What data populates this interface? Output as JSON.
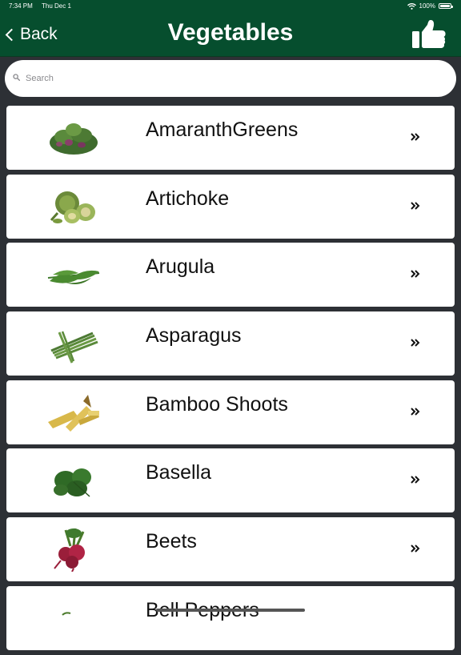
{
  "status_bar": {
    "time": "7:34 PM",
    "date": "Thu Dec 1",
    "battery": "100%"
  },
  "nav": {
    "back_label": "Back",
    "title": "Vegetables",
    "like_icon": "thumbs-up-icon"
  },
  "search": {
    "placeholder": "Search",
    "value": ""
  },
  "vegetables": [
    {
      "name": "AmaranthGreens",
      "image": "amaranth-greens-image"
    },
    {
      "name": "Artichoke",
      "image": "artichoke-image"
    },
    {
      "name": "Arugula",
      "image": "arugula-image"
    },
    {
      "name": "Asparagus",
      "image": "asparagus-image"
    },
    {
      "name": "Bamboo Shoots",
      "image": "bamboo-shoots-image"
    },
    {
      "name": "Basella",
      "image": "basella-image"
    },
    {
      "name": "Beets",
      "image": "beets-image"
    },
    {
      "name": "Bell Peppers",
      "image": "bell-peppers-image"
    }
  ],
  "colors": {
    "header": "#064e2e",
    "background": "#2d3035",
    "row": "#ffffff",
    "text": "#111111"
  }
}
